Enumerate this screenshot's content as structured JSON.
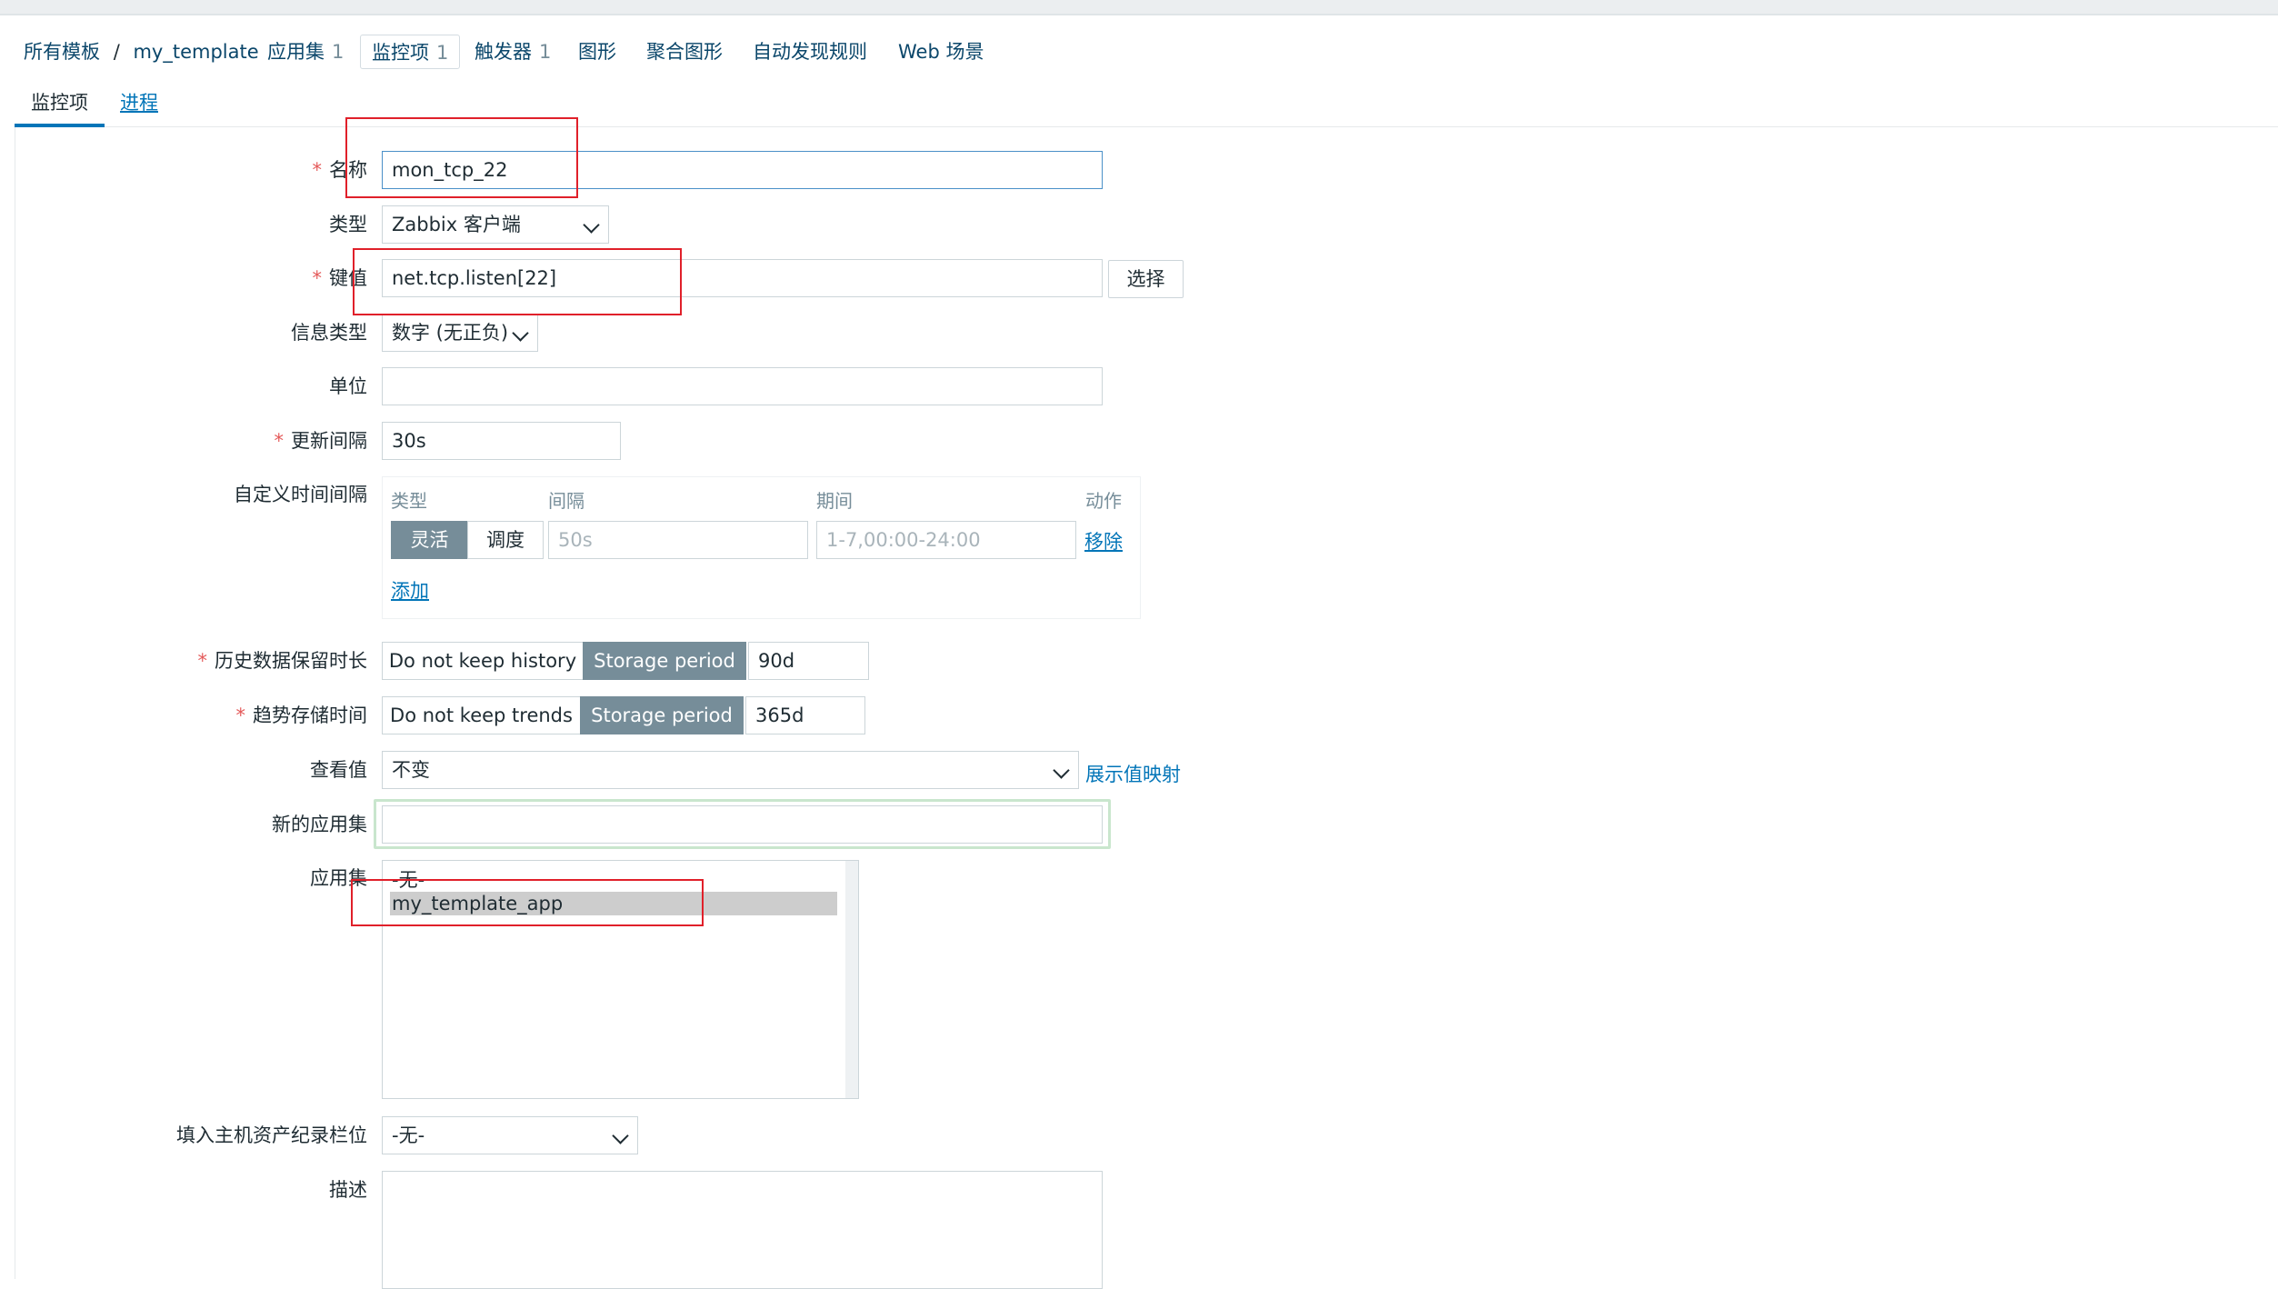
{
  "breadcrumb": {
    "all_templates": "所有模板",
    "sep": "/",
    "template": "my_template",
    "applications": "应用集",
    "applications_count": "1",
    "items": "监控项",
    "items_count": "1",
    "triggers": "触发器",
    "triggers_count": "1",
    "graphs": "图形",
    "screens": "聚合图形",
    "discovery": "自动发现规则",
    "web": "Web 场景"
  },
  "tabs": [
    "监控项",
    "进程"
  ],
  "form": {
    "name": {
      "label": "名称",
      "value": "mon_tcp_22"
    },
    "type": {
      "label": "类型",
      "value": "Zabbix 客户端"
    },
    "key": {
      "label": "键值",
      "value": "net.tcp.listen[22]",
      "select_button": "选择"
    },
    "info_type": {
      "label": "信息类型",
      "value": "数字 (无正负)"
    },
    "units": {
      "label": "单位",
      "value": ""
    },
    "update_interval": {
      "label": "更新间隔",
      "value": "30s"
    },
    "custom_intervals": {
      "label": "自定义时间间隔",
      "headers": {
        "type": "类型",
        "interval": "间隔",
        "period": "期间",
        "action": "动作"
      },
      "flexible": "灵活",
      "scheduling": "调度",
      "interval_placeholder": "50s",
      "period_placeholder": "1-7,00:00-24:00",
      "remove": "移除",
      "add": "添加"
    },
    "history": {
      "label": "历史数据保留时长",
      "off": "Do not keep history",
      "on": "Storage period",
      "value": "90d"
    },
    "trends": {
      "label": "趋势存储时间",
      "off": "Do not keep trends",
      "on": "Storage period",
      "value": "365d"
    },
    "show_value": {
      "label": "查看值",
      "value": "不变",
      "link": "展示值映射"
    },
    "new_application": {
      "label": "新的应用集",
      "value": ""
    },
    "applications": {
      "label": "应用集",
      "options": [
        "-无-",
        "my_template_app"
      ],
      "selected": "my_template_app"
    },
    "inventory": {
      "label": "填入主机资产纪录栏位",
      "value": "-无-"
    },
    "description": {
      "label": "描述",
      "value": ""
    }
  },
  "colors": {
    "accent": "#0275b8",
    "highlight_red": "#e0202a",
    "segment_on": "#768d99"
  }
}
